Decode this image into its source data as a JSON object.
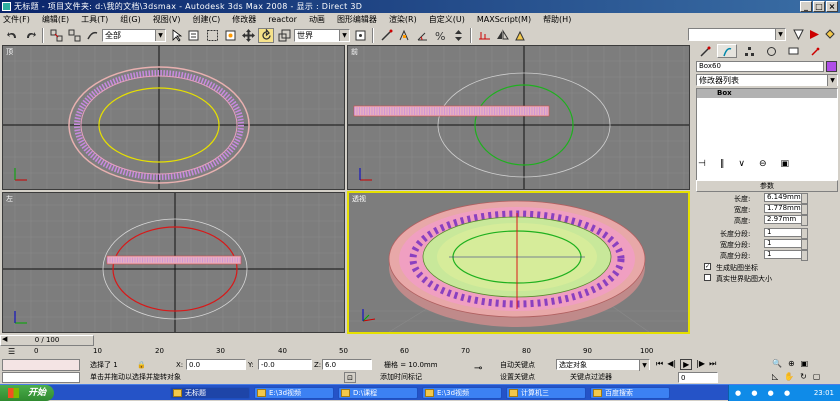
{
  "titlebar": {
    "app_icon": "3dsmax-icon",
    "text": "无标题   - 项目文件夹: d:\\我的文档\\3dsmax      - Autodesk 3ds Max 2008      - 显示 : Direct 3D"
  },
  "menu": [
    "文件(F)",
    "编辑(E)",
    "工具(T)",
    "组(G)",
    "视图(V)",
    "创建(C)",
    "修改器",
    "reactor",
    "动画",
    "图形编辑器",
    "渲染(R)",
    "自定义(U)",
    "MAXScript(M)",
    "帮助(H)"
  ],
  "toolbar": {
    "selection_filter": "全部",
    "ref_coord": "世界",
    "named_set": "",
    "icons": [
      "undo-icon",
      "redo-icon",
      "link-icon",
      "unlink-icon",
      "bind-space-warp-icon",
      "select-icon",
      "select-by-name-icon",
      "rect-select-icon",
      "window-crossing-icon",
      "move-icon",
      "rotate-icon",
      "scale-icon",
      "pivot-icon",
      "mirror-icon",
      "align-icon",
      "snap-icon",
      "angle-snap-icon",
      "percent-snap-icon",
      "spinner-snap-icon"
    ]
  },
  "viewports": {
    "top": {
      "label": "顶"
    },
    "front": {
      "label": "前"
    },
    "left": {
      "label": "左"
    },
    "perspective": {
      "label": "透视"
    }
  },
  "command_panel": {
    "object_name": "Box60",
    "object_color": "#b04fe8",
    "modifier_list": "修改器列表",
    "stack_item": "Box",
    "rollout_title": "参数",
    "params": [
      {
        "label": "长度:",
        "value": "6.149mm"
      },
      {
        "label": "宽度:",
        "value": "1.778mm"
      },
      {
        "label": "高度:",
        "value": "2.97mm"
      },
      {
        "label": "长度分段:",
        "value": "1"
      },
      {
        "label": "宽度分段:",
        "value": "1"
      },
      {
        "label": "高度分段:",
        "value": "1"
      }
    ],
    "checkbox_mapping": {
      "label": "生成贴图坐标",
      "checked": true
    },
    "checkbox_realworld": {
      "label": "真实世界贴图大小",
      "checked": false
    }
  },
  "timeline": {
    "slider_text": "0 / 100",
    "ticks": [
      "0",
      "10",
      "20",
      "30",
      "40",
      "50",
      "60",
      "70",
      "80",
      "90",
      "100"
    ]
  },
  "status": {
    "selected": "选择了 1",
    "x_label": "X:",
    "x_value": "0.0",
    "y_label": "Y:",
    "y_value": "-0.0",
    "z_label": "Z:",
    "z_value": "6.0",
    "grid": "栅格 = 10.0mm",
    "prompt": "单击并拖动以选择并旋转对象",
    "add_time_tag": "添加时间标记",
    "auto_key": "自动关键点",
    "set_key": "设置关键点",
    "key_mode": "选定对象",
    "key_filters": "关键点过滤器",
    "frame": "0"
  },
  "taskbar": {
    "start": "开始",
    "tasks": [
      "无标题",
      "E:\\3d视频",
      "D:\\课程",
      "E:\\3d视频",
      "计算机三",
      "百度搜索"
    ],
    "clock": "23:01"
  }
}
